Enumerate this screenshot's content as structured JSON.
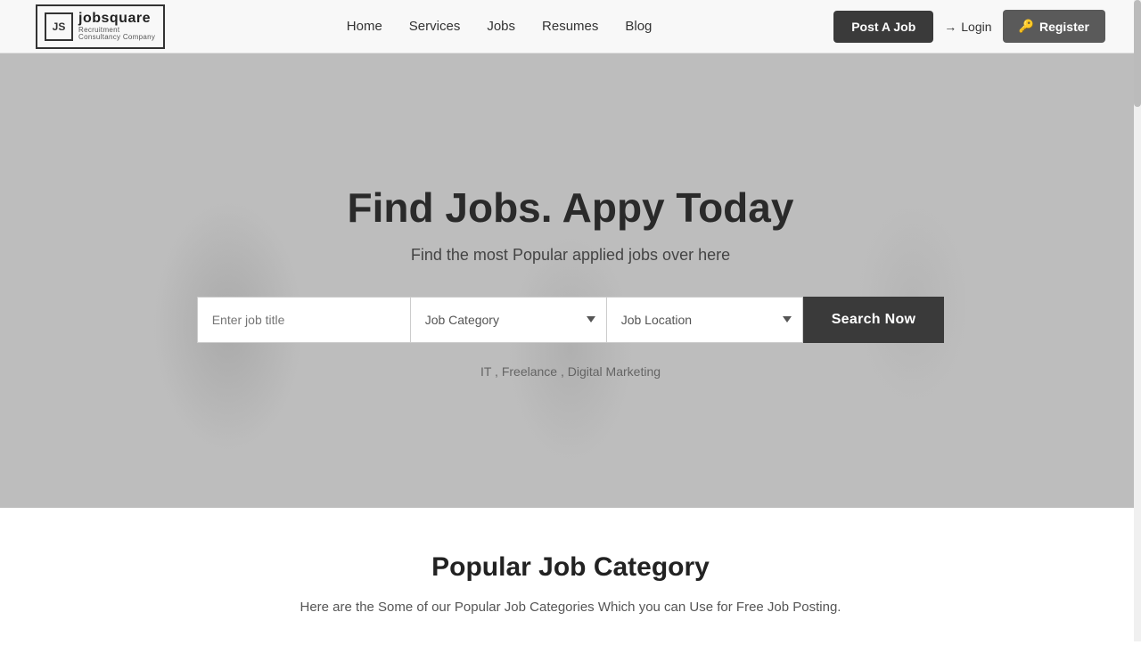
{
  "logo": {
    "initials": "JS",
    "name": "jobsquare",
    "tagline": "Recruitment Consultancy Company"
  },
  "nav": {
    "links": [
      {
        "label": "Home",
        "href": "#"
      },
      {
        "label": "Services",
        "href": "#"
      },
      {
        "label": "Jobs",
        "href": "#"
      },
      {
        "label": "Resumes",
        "href": "#"
      },
      {
        "label": "Blog",
        "href": "#"
      }
    ],
    "post_job_label": "Post A Job",
    "login_label": "Login",
    "register_label": "Register"
  },
  "hero": {
    "title": "Find Jobs. Appy Today",
    "subtitle": "Find the most Popular applied jobs over here",
    "search": {
      "input_placeholder": "Enter job title",
      "category_placeholder": "Job Category",
      "location_placeholder": "Job Location",
      "button_label": "Search Now"
    },
    "tags": "IT , Freelance , Digital Marketing"
  },
  "popular": {
    "title": "Popular Job Category",
    "subtitle": "Here are the Some of our Popular  Job Categories Which you can Use for Free Job Posting."
  }
}
